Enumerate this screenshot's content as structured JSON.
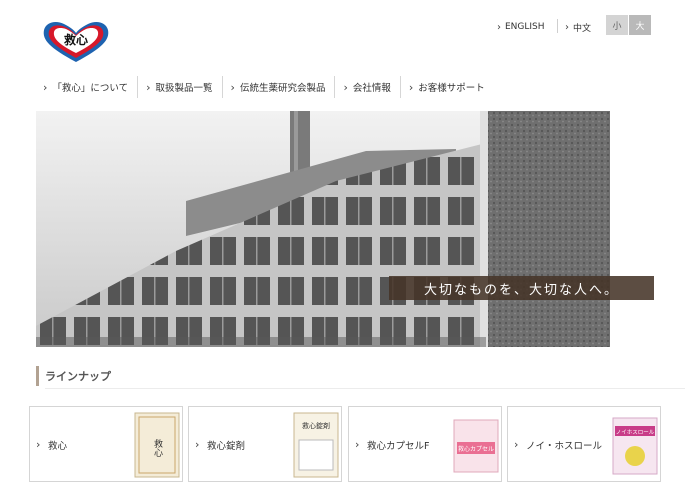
{
  "header": {
    "logo_text": "救心",
    "lang_en": "ENGLISH",
    "lang_cn": "中文",
    "font_small": "小",
    "font_large": "大"
  },
  "nav": {
    "items": [
      {
        "label": "「救心」について"
      },
      {
        "label": "取扱製品一覧"
      },
      {
        "label": "伝統生薬研究会製品"
      },
      {
        "label": "会社情報"
      },
      {
        "label": "お客様サポート"
      }
    ]
  },
  "hero": {
    "tagline": "大切なものを、大切な人へ。"
  },
  "lineup": {
    "title": "ラインナップ",
    "products": [
      {
        "name": "救心",
        "package_text": "救心"
      },
      {
        "name": "救心錠剤",
        "package_text": "救心錠剤"
      },
      {
        "name": "救心カプセルF",
        "package_text": "救心カプセル"
      },
      {
        "name": "ノイ・ホスロール",
        "package_text": "ノイホスロール"
      }
    ]
  },
  "colors": {
    "brand_red": "#d7182a",
    "brand_blue": "#1e63b0",
    "tagline_bg": "#463428",
    "section_accent": "#b2a292"
  }
}
